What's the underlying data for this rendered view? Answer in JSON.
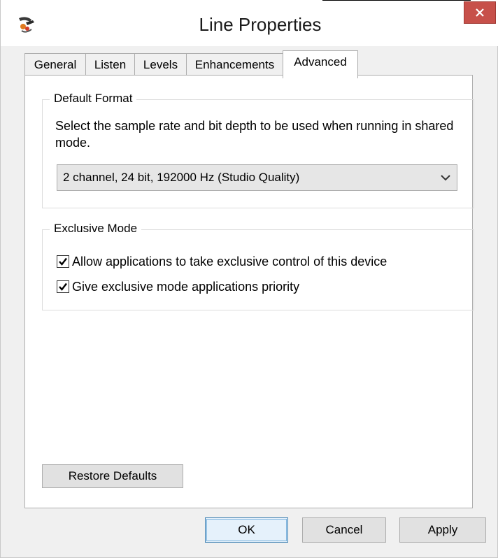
{
  "window": {
    "title": "Line Properties",
    "icons": {
      "app": "sound-line-icon",
      "close": "close-icon"
    }
  },
  "tabs": [
    {
      "label": "General"
    },
    {
      "label": "Listen"
    },
    {
      "label": "Levels"
    },
    {
      "label": "Enhancements"
    },
    {
      "label": "Advanced",
      "active": true
    }
  ],
  "default_format": {
    "legend": "Default Format",
    "description": "Select the sample rate and bit depth to be used when running in shared mode.",
    "selected": "2 channel, 24 bit, 192000 Hz (Studio Quality)"
  },
  "exclusive_mode": {
    "legend": "Exclusive Mode",
    "options": [
      {
        "label": "Allow applications to take exclusive control of this device",
        "checked": true
      },
      {
        "label": "Give exclusive mode applications priority",
        "checked": true
      }
    ]
  },
  "buttons": {
    "restore": "Restore Defaults",
    "ok": "OK",
    "cancel": "Cancel",
    "apply": "Apply"
  },
  "colors": {
    "close_button": "#c7504a",
    "default_button_border": "#3c7fb1"
  }
}
